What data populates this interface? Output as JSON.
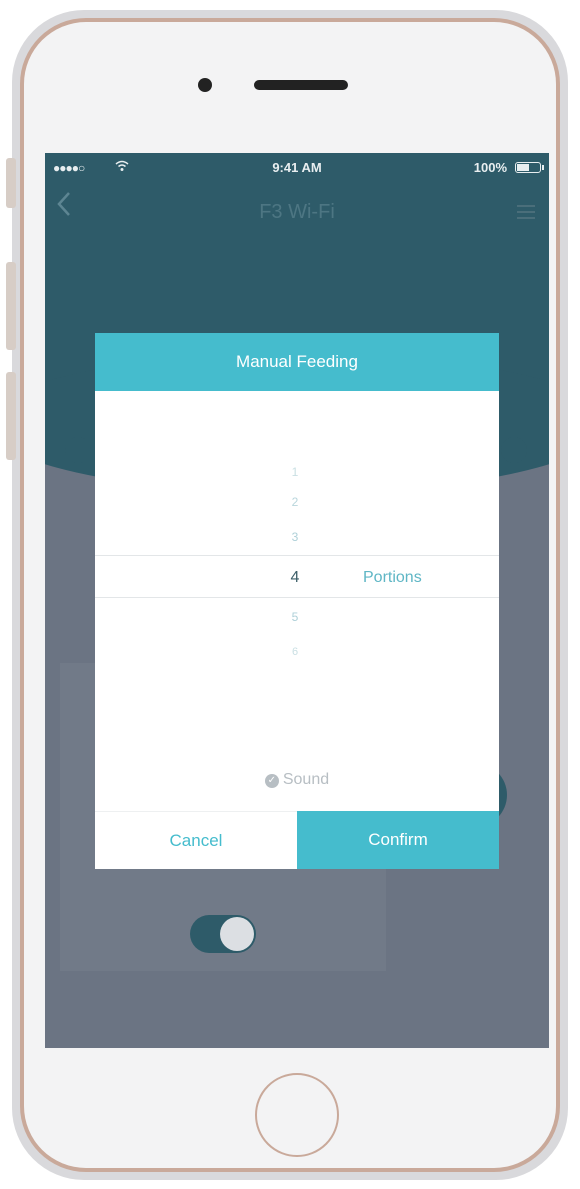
{
  "status_bar": {
    "signal": "●●●●○",
    "wifi": "wifi-icon",
    "time": "9:41 AM",
    "battery": "100%"
  },
  "app": {
    "title": "F3 Wi-Fi",
    "back_icon": "chevron-left-icon",
    "menu_icon": "menu-icon"
  },
  "dialog": {
    "title": "Manual Feeding",
    "picker": {
      "options": [
        "1",
        "2",
        "3",
        "4",
        "5",
        "6"
      ],
      "selected": "4",
      "unit": "Portions"
    },
    "sound_label": "Sound",
    "sound_checked": true,
    "cancel_label": "Cancel",
    "confirm_label": "Confirm"
  },
  "colors": {
    "accent": "#45bccd",
    "header": "#2e5b69",
    "overlay": "#6b7483"
  }
}
